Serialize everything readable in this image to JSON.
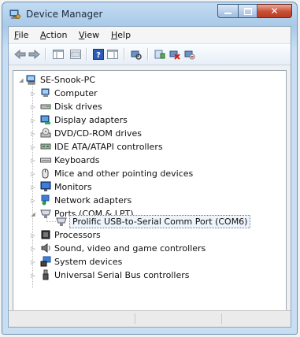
{
  "window": {
    "title": "Device Manager"
  },
  "menu": [
    {
      "label": "File",
      "mnemonic": "F",
      "rest": "ile"
    },
    {
      "label": "Action",
      "mnemonic": "A",
      "rest": "ction"
    },
    {
      "label": "View",
      "mnemonic": "V",
      "rest": "iew"
    },
    {
      "label": "Help",
      "mnemonic": "H",
      "rest": "elp"
    }
  ],
  "toolbar": {
    "icons": [
      "back-icon",
      "forward-icon",
      "show-hide-console-tree-icon",
      "properties-icon",
      "help-icon",
      "show-action-pane-icon",
      "scan-hardware-icon",
      "update-driver-icon",
      "disable-device-icon",
      "uninstall-device-icon"
    ]
  },
  "tree": {
    "root": {
      "label": "SE-Snook-PC",
      "icon": "computer-icon"
    },
    "categories": [
      {
        "label": "Computer",
        "icon": "computer-icon",
        "expanded": false
      },
      {
        "label": "Disk drives",
        "icon": "disk-drive-icon",
        "expanded": false
      },
      {
        "label": "Display adapters",
        "icon": "display-adapter-icon",
        "expanded": false
      },
      {
        "label": "DVD/CD-ROM drives",
        "icon": "cdrom-icon",
        "expanded": false
      },
      {
        "label": "IDE ATA/ATAPI controllers",
        "icon": "ide-controller-icon",
        "expanded": false
      },
      {
        "label": "Keyboards",
        "icon": "keyboard-icon",
        "expanded": false
      },
      {
        "label": "Mice and other pointing devices",
        "icon": "mouse-icon",
        "expanded": false
      },
      {
        "label": "Monitors",
        "icon": "monitor-icon",
        "expanded": false
      },
      {
        "label": "Network adapters",
        "icon": "network-adapter-icon",
        "expanded": false
      },
      {
        "label": "Ports (COM & LPT)",
        "icon": "port-icon",
        "expanded": true
      },
      {
        "label": "Prolific USB-to-Serial Comm Port (COM6)",
        "icon": "port-icon",
        "child": true,
        "selected": true
      },
      {
        "label": "Processors",
        "icon": "processor-icon",
        "expanded": false
      },
      {
        "label": "Sound, video and game controllers",
        "icon": "speaker-icon",
        "expanded": false
      },
      {
        "label": "System devices",
        "icon": "system-device-icon",
        "expanded": false
      },
      {
        "label": "Universal Serial Bus controllers",
        "icon": "usb-icon",
        "expanded": false
      }
    ]
  },
  "colors": {
    "title_bar": "#b9d4ef",
    "close_button": "#c74f35",
    "selection_border": "#5c7a9a"
  }
}
